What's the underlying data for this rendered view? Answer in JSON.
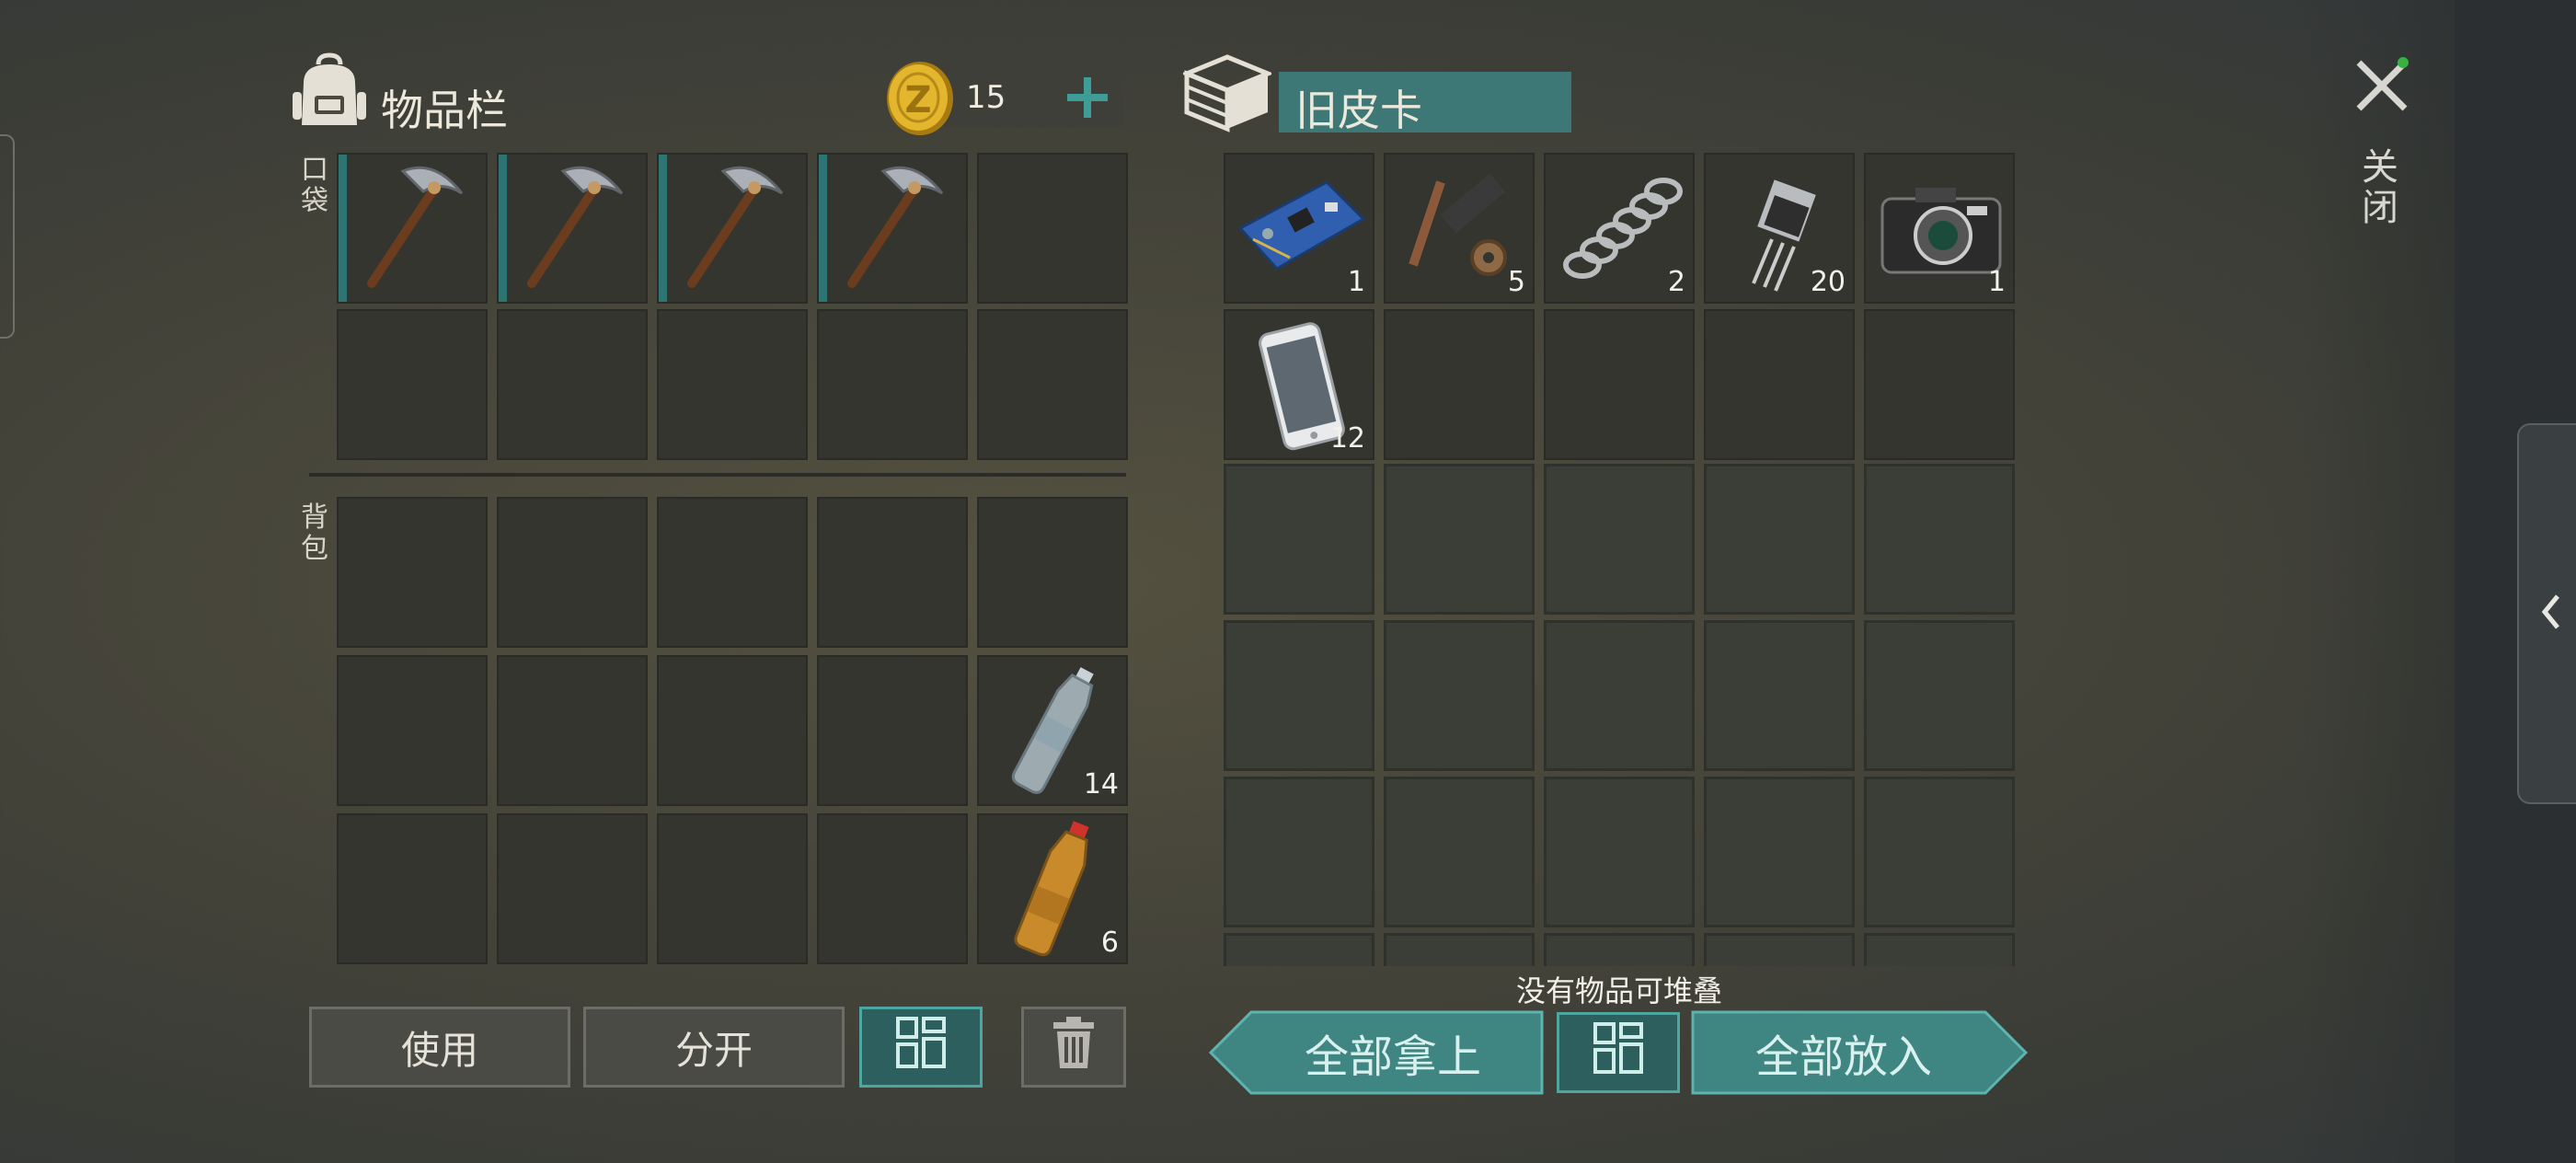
{
  "inventory": {
    "title": "物品栏",
    "coins": "15",
    "pocket_label": "口袋",
    "backpack_label": "背包",
    "pocket_slots": [
      {
        "item": "pickaxe-icon",
        "qty": ""
      },
      {
        "item": "pickaxe-icon",
        "qty": ""
      },
      {
        "item": "pickaxe-icon",
        "qty": ""
      },
      {
        "item": "pickaxe-icon",
        "qty": ""
      },
      {
        "item": "",
        "qty": ""
      },
      {
        "item": "",
        "qty": ""
      },
      {
        "item": "",
        "qty": ""
      },
      {
        "item": "",
        "qty": ""
      },
      {
        "item": "",
        "qty": ""
      },
      {
        "item": "",
        "qty": ""
      }
    ],
    "backpack_slots": [
      {
        "item": "",
        "qty": ""
      },
      {
        "item": "",
        "qty": ""
      },
      {
        "item": "",
        "qty": ""
      },
      {
        "item": "",
        "qty": ""
      },
      {
        "item": "",
        "qty": ""
      },
      {
        "item": "",
        "qty": ""
      },
      {
        "item": "",
        "qty": ""
      },
      {
        "item": "",
        "qty": ""
      },
      {
        "item": "",
        "qty": ""
      },
      {
        "item": "water-bottle-icon",
        "qty": "14"
      },
      {
        "item": "",
        "qty": ""
      },
      {
        "item": "",
        "qty": ""
      },
      {
        "item": "",
        "qty": ""
      },
      {
        "item": "",
        "qty": ""
      },
      {
        "item": "soda-bottle-icon",
        "qty": "6"
      }
    ],
    "use_label": "使用",
    "split_label": "分开"
  },
  "container": {
    "title": "旧皮卡",
    "slots": [
      {
        "item": "circuit-board-icon",
        "qty": "1"
      },
      {
        "item": "scrap-parts-icon",
        "qty": "5"
      },
      {
        "item": "spring-icon",
        "qty": "2"
      },
      {
        "item": "transistor-icon",
        "qty": "20"
      },
      {
        "item": "camera-icon",
        "qty": "1"
      },
      {
        "item": "smartphone-icon",
        "qty": "12"
      },
      {
        "item": "",
        "qty": ""
      },
      {
        "item": "",
        "qty": ""
      },
      {
        "item": "",
        "qty": ""
      },
      {
        "item": "",
        "qty": ""
      }
    ],
    "no_stack_message": "没有物品可堆叠",
    "take_all_label": "全部拿上",
    "put_all_label": "全部放入"
  },
  "close_label": "关闭",
  "colors": {
    "accent": "#2e7473",
    "teal_button": "#2c5f5d",
    "container_title_bg": "#3d7876",
    "plus": "#3e9e97"
  }
}
